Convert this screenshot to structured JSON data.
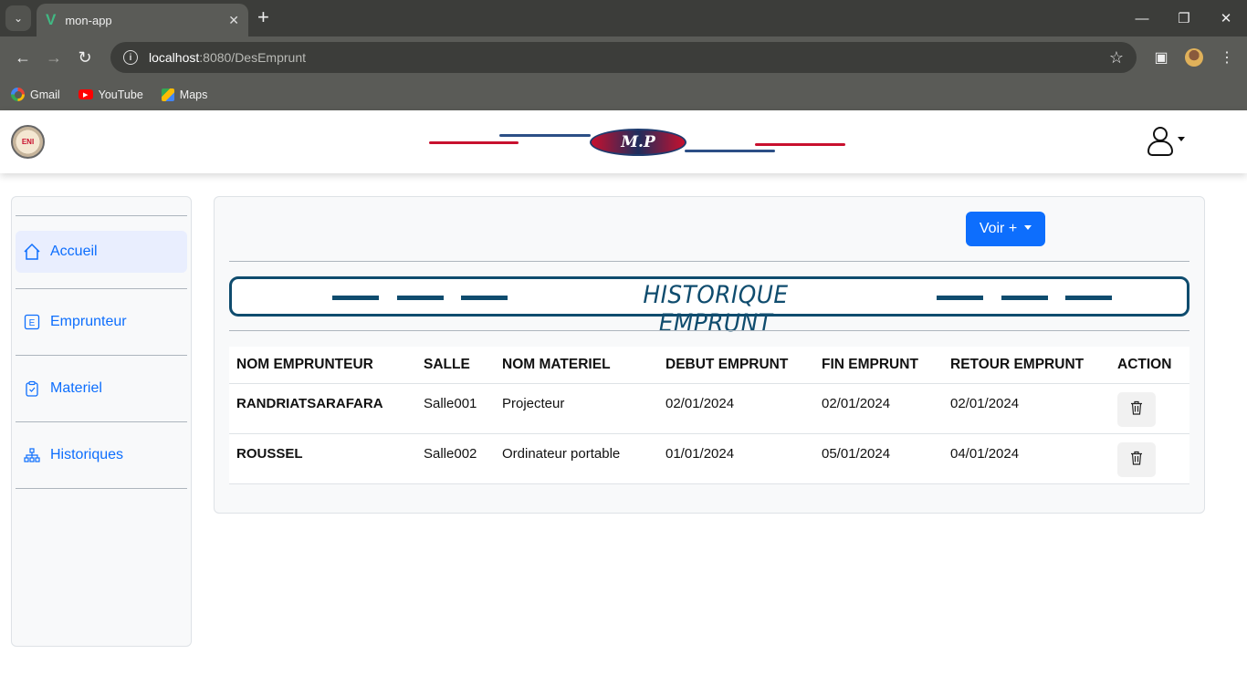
{
  "browser": {
    "tab_title": "mon-app",
    "url_host": "localhost",
    "url_path": ":8080/DesEmprunt",
    "bookmarks": [
      {
        "label": "Gmail",
        "icon": "google-icon"
      },
      {
        "label": "YouTube",
        "icon": "youtube-icon"
      },
      {
        "label": "Maps",
        "icon": "maps-icon"
      }
    ]
  },
  "header": {
    "brand_text": "M.P",
    "colors": {
      "red": "#c8102e",
      "blue": "#2c4f86"
    }
  },
  "sidebar": {
    "items": [
      {
        "label": "Accueil",
        "icon": "home-icon"
      },
      {
        "label": "Emprunteur",
        "icon": "e-box-icon"
      },
      {
        "label": "Materiel",
        "icon": "clipboard-icon"
      },
      {
        "label": "Historiques",
        "icon": "diagram-icon"
      }
    ]
  },
  "main": {
    "voir_button": "Voir +",
    "banner_title": "HISTORIQUE EMPRUNT",
    "table": {
      "headers": [
        "NOM EMPRUNTEUR",
        "SALLE",
        "NOM MATERIEL",
        "DEBUT EMPRUNT",
        "FIN EMPRUNT",
        "RETOUR EMPRUNT",
        "ACTION"
      ],
      "rows": [
        [
          "RANDRIATSARAFARA",
          "Salle001",
          "Projecteur",
          "02/01/2024",
          "02/01/2024",
          "02/01/2024"
        ],
        [
          "ROUSSEL",
          "Salle002",
          "Ordinateur portable",
          "01/01/2024",
          "05/01/2024",
          "04/01/2024"
        ]
      ]
    }
  },
  "colors": {
    "primary": "#0d6efd",
    "banner": "#0f4c6e"
  }
}
